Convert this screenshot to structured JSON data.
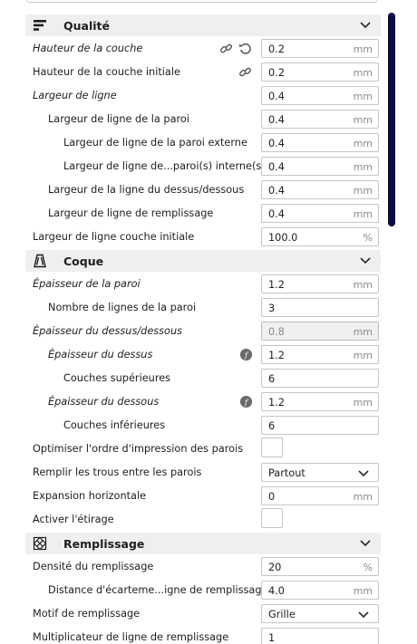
{
  "sections": {
    "qualite": {
      "title": "Qualité",
      "icon": "quality-icon",
      "rows": [
        {
          "label": "Hauteur de la couche",
          "value": "0.2",
          "unit": "mm"
        },
        {
          "label": "Hauteur de la couche initiale",
          "value": "0.2",
          "unit": "mm"
        },
        {
          "label": "Largeur de ligne",
          "value": "0.4",
          "unit": "mm"
        },
        {
          "label": "Largeur de ligne de la paroi",
          "value": "0.4",
          "unit": "mm"
        },
        {
          "label": "Largeur de ligne de la paroi externe",
          "value": "0.4",
          "unit": "mm"
        },
        {
          "label": "Largeur de ligne de...paroi(s) interne(s)",
          "value": "0.4",
          "unit": "mm"
        },
        {
          "label": "Largeur de la ligne du dessus/dessous",
          "value": "0.4",
          "unit": "mm"
        },
        {
          "label": "Largeur de ligne de remplissage",
          "value": "0.4",
          "unit": "mm"
        },
        {
          "label": "Largeur de ligne couche initiale",
          "value": "100.0",
          "unit": "%"
        }
      ]
    },
    "coque": {
      "title": "Coque",
      "icon": "shell-icon",
      "rows": [
        {
          "label": "Épaisseur de la paroi",
          "value": "1.2",
          "unit": "mm"
        },
        {
          "label": "Nombre de lignes de la paroi",
          "value": "3",
          "unit": ""
        },
        {
          "label": "Épaisseur du dessus/dessous",
          "value": "0.8",
          "unit": "mm"
        },
        {
          "label": "Épaisseur du dessus",
          "value": "1.2",
          "unit": "mm"
        },
        {
          "label": "Couches supérieures",
          "value": "6",
          "unit": ""
        },
        {
          "label": "Épaisseur du dessous",
          "value": "1.2",
          "unit": "mm"
        },
        {
          "label": "Couches inférieures",
          "value": "6",
          "unit": ""
        },
        {
          "label": "Optimiser l'ordre d'impression des parois",
          "checked": false
        },
        {
          "label": "Remplir les trous entre les parois",
          "selected": "Partout"
        },
        {
          "label": "Expansion horizontale",
          "value": "0",
          "unit": "mm"
        },
        {
          "label": "Activer l'étirage",
          "checked": false
        }
      ]
    },
    "remplissage": {
      "title": "Remplissage",
      "icon": "infill-icon",
      "rows": [
        {
          "label": "Densité du remplissage",
          "value": "20",
          "unit": "%"
        },
        {
          "label": "Distance d'écarteme...igne de remplissage",
          "value": "4.0",
          "unit": "mm"
        },
        {
          "label": "Motif de remplissage",
          "selected": "Grille"
        },
        {
          "label": "Multiplicateur de ligne de remplissage",
          "value": "1",
          "unit": ""
        }
      ]
    }
  },
  "colors": {
    "accent": "#0b0b3e",
    "header_bg": "#efefef",
    "field_border": "#c6c6c6",
    "unit_text": "#8c8c8c"
  },
  "icons": [
    "link-icon",
    "reset-icon",
    "function-icon",
    "chevron-down-icon"
  ]
}
